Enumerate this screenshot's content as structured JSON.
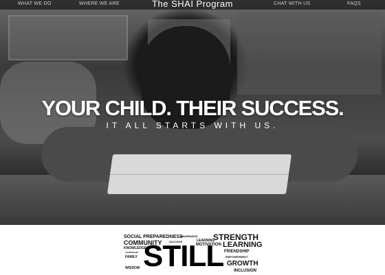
{
  "nav": {
    "items": [
      "WHAT WE DO",
      "WHERE WE ARE",
      "CHAT WITH US",
      "FAQS"
    ],
    "title": "The SHAI Program"
  },
  "hero": {
    "headline": "YOUR CHILD. THEIR SUCCESS.",
    "subheadline": "IT ALL STARTS WITH US."
  },
  "word_cloud": {
    "main": "STILL",
    "words": [
      "SOCIAL PREPAREDNESS",
      "AWARENESS",
      "STRENGTH",
      "COMMUNITY",
      "SUCCESS",
      "LEARNING",
      "MOTIVATION",
      "LEARNING",
      "KNOWLEDGE",
      "FRIENDSHIP",
      "LEADERSHIP",
      "FAMILY",
      "EMPOWERMENT",
      "WISDOM",
      "GROWTH",
      "INCLUSION"
    ]
  }
}
